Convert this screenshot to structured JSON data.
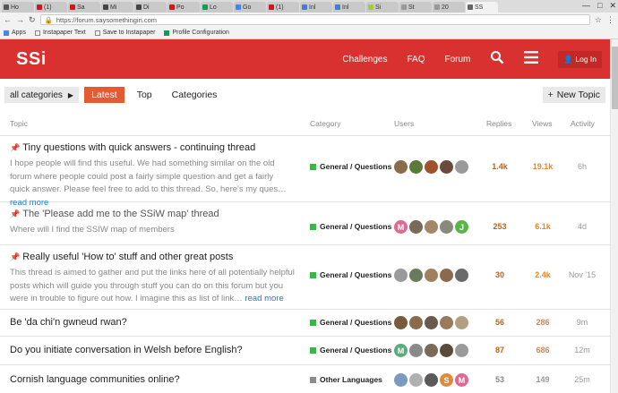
{
  "browser": {
    "tabs": [
      {
        "label": "Ho",
        "color": "#555"
      },
      {
        "label": "(1)",
        "color": "#cc181e"
      },
      {
        "label": "Sa",
        "color": "#cc181e"
      },
      {
        "label": "Mi",
        "color": "#444"
      },
      {
        "label": "Di",
        "color": "#444"
      },
      {
        "label": "Po",
        "color": "#cc181e"
      },
      {
        "label": "Lo",
        "color": "#0f9d58"
      },
      {
        "label": "Go",
        "color": "#4285f4"
      },
      {
        "label": "(1)",
        "color": "#cc181e"
      },
      {
        "label": "Inl",
        "color": "#4a7bd2"
      },
      {
        "label": "Inl",
        "color": "#4a7bd2"
      },
      {
        "label": "Si",
        "color": "#aac93a"
      },
      {
        "label": "St",
        "color": "#999"
      },
      {
        "label": "20",
        "color": "#999"
      },
      {
        "label": "SS",
        "color": "#666"
      }
    ],
    "url": "https://forum.saysomethingin.com",
    "bookmarks": [
      "Apps",
      "Instapaper Text",
      "Save to Instapaper",
      "Profile Configuration"
    ]
  },
  "header": {
    "logo": "SSi",
    "nav": [
      "Challenges",
      "FAQ",
      "Forum"
    ],
    "login": "Log In"
  },
  "subnav": {
    "category_dropdown": "all categories",
    "tabs": [
      "Latest",
      "Top",
      "Categories"
    ],
    "new_topic": "New Topic"
  },
  "table": {
    "headers": {
      "topic": "Topic",
      "category": "Category",
      "users": "Users",
      "replies": "Replies",
      "views": "Views",
      "activity": "Activity"
    },
    "rows": [
      {
        "title": "Tiny questions with quick answers - continuing thread",
        "pinned": true,
        "excerpt": "I hope people will find this useful. We had something similar on the old forum where people could post a fairly simple question and get a fairly quick answer. Please feel free to add to this thread. So, here's my ques…",
        "more": "read more",
        "category": "General / Questions",
        "cat_color": "#3ab54a",
        "replies": "1.4k",
        "views": "19.1k",
        "activity": "6h",
        "avatars": [
          "#8a6b4a",
          "#5b7a3a",
          "#a0522d",
          "#6a4a3a",
          "#9a9a9a"
        ]
      },
      {
        "title": "The 'Please add me to the SSiW map' thread",
        "pinned": true,
        "muted": true,
        "excerpt": "Where will I find the SSIW map of members",
        "more": "",
        "category": "General / Questions",
        "cat_color": "#3ab54a",
        "replies": "253",
        "views": "6.1k",
        "activity": "4d",
        "avatars": [
          "M",
          "#7a6a5a",
          "#a38766",
          "#8a8a7a",
          "J"
        ]
      },
      {
        "title": "Really useful 'How to' stuff and other great posts",
        "pinned": true,
        "excerpt": "This thread is aimed to gather and put the links here of all potentially helpful posts which will guide you through stuff you can do on this forum but you were in trouble to figure out how. I imagine this as list of link…",
        "more": "read more",
        "category": "General / Questions",
        "cat_color": "#3ab54a",
        "replies": "30",
        "views": "2.4k",
        "activity": "Nov '15",
        "avatars": [
          "#9a9a9a",
          "#6a7a5a",
          "#a08060",
          "#8a6a4a",
          "#6a6a6a"
        ]
      },
      {
        "title": "Be 'da chi'n gwneud rwan?",
        "pinned": false,
        "excerpt": "",
        "more": "",
        "category": "General / Questions",
        "cat_color": "#3ab54a",
        "replies": "56",
        "views": "286",
        "activity": "9m",
        "avatars": [
          "#7a5a3a",
          "#8a6a4a",
          "#6a5a4a",
          "#9a7a5a",
          "#b0a080"
        ]
      },
      {
        "title": "Do you initiate conversation in Welsh before English?",
        "pinned": false,
        "excerpt": "",
        "more": "",
        "category": "General / Questions",
        "cat_color": "#3ab54a",
        "replies": "87",
        "views": "686",
        "activity": "12m",
        "avatars": [
          "M",
          "#8a8a8a",
          "#7a6a5a",
          "#5a4a3a",
          "#9a9a9a"
        ]
      },
      {
        "title": "Cornish language communities online?",
        "pinned": false,
        "excerpt": "",
        "more": "",
        "category": "Other Languages",
        "cat_color": "#8c8c8c",
        "replies": "53",
        "views": "149",
        "activity": "25m",
        "avatars": [
          "#7a9ac0",
          "#b0b0b0",
          "#5a5a5a",
          "S",
          "M"
        ]
      }
    ]
  }
}
